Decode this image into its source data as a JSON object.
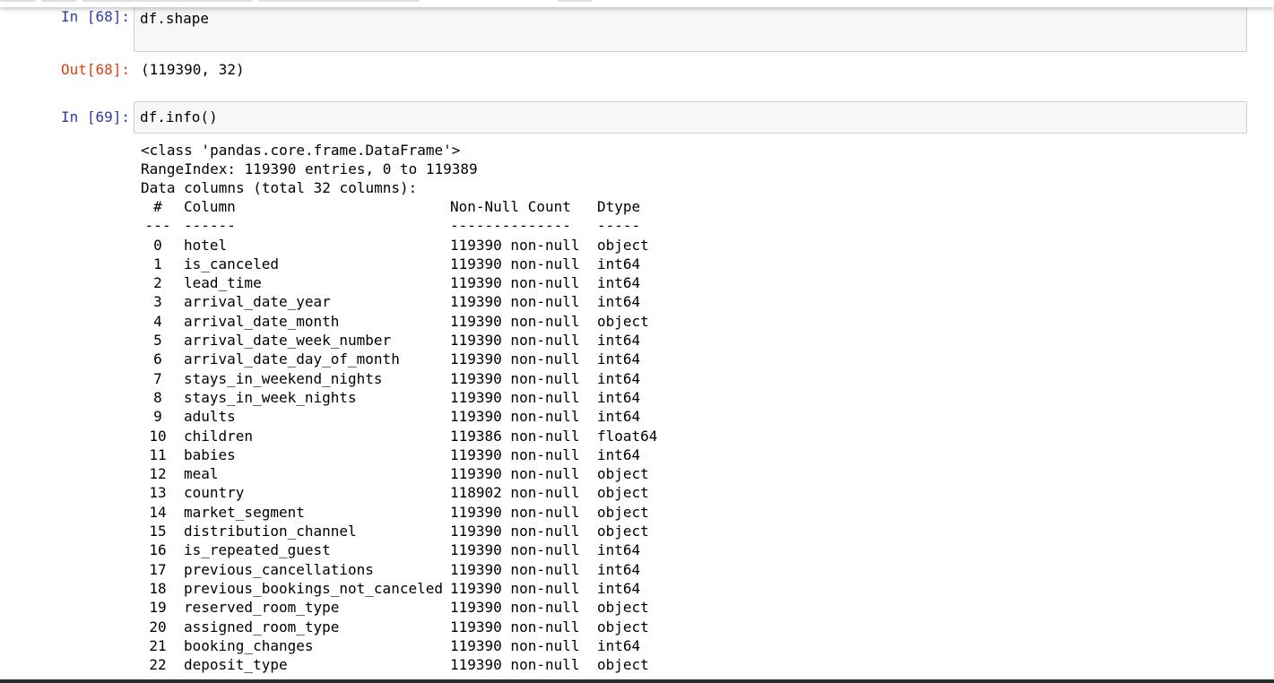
{
  "cells": [
    {
      "in_prompt": "In [68]:",
      "code": "df.shape",
      "out_prompt": "Out[68]:",
      "output": "(119390, 32)"
    },
    {
      "in_prompt": "In [69]:",
      "code": "df.info()",
      "info": {
        "class_line": "<class 'pandas.core.frame.DataFrame'>",
        "range_index_line": "RangeIndex: 119390 entries, 0 to 119389",
        "data_columns_line": "Data columns (total 32 columns):",
        "headers": {
          "idx": "#",
          "column": "Column",
          "count": "Non-Null Count",
          "dtype": "Dtype"
        },
        "separators": {
          "idx": "---",
          "column": "------",
          "count": "--------------",
          "dtype": "-----"
        },
        "rows": [
          {
            "idx": "0",
            "column": "hotel",
            "count": "119390 non-null",
            "dtype": "object"
          },
          {
            "idx": "1",
            "column": "is_canceled",
            "count": "119390 non-null",
            "dtype": "int64"
          },
          {
            "idx": "2",
            "column": "lead_time",
            "count": "119390 non-null",
            "dtype": "int64"
          },
          {
            "idx": "3",
            "column": "arrival_date_year",
            "count": "119390 non-null",
            "dtype": "int64"
          },
          {
            "idx": "4",
            "column": "arrival_date_month",
            "count": "119390 non-null",
            "dtype": "object"
          },
          {
            "idx": "5",
            "column": "arrival_date_week_number",
            "count": "119390 non-null",
            "dtype": "int64"
          },
          {
            "idx": "6",
            "column": "arrival_date_day_of_month",
            "count": "119390 non-null",
            "dtype": "int64"
          },
          {
            "idx": "7",
            "column": "stays_in_weekend_nights",
            "count": "119390 non-null",
            "dtype": "int64"
          },
          {
            "idx": "8",
            "column": "stays_in_week_nights",
            "count": "119390 non-null",
            "dtype": "int64"
          },
          {
            "idx": "9",
            "column": "adults",
            "count": "119390 non-null",
            "dtype": "int64"
          },
          {
            "idx": "10",
            "column": "children",
            "count": "119386 non-null",
            "dtype": "float64"
          },
          {
            "idx": "11",
            "column": "babies",
            "count": "119390 non-null",
            "dtype": "int64"
          },
          {
            "idx": "12",
            "column": "meal",
            "count": "119390 non-null",
            "dtype": "object"
          },
          {
            "idx": "13",
            "column": "country",
            "count": "118902 non-null",
            "dtype": "object"
          },
          {
            "idx": "14",
            "column": "market_segment",
            "count": "119390 non-null",
            "dtype": "object"
          },
          {
            "idx": "15",
            "column": "distribution_channel",
            "count": "119390 non-null",
            "dtype": "object"
          },
          {
            "idx": "16",
            "column": "is_repeated_guest",
            "count": "119390 non-null",
            "dtype": "int64"
          },
          {
            "idx": "17",
            "column": "previous_cancellations",
            "count": "119390 non-null",
            "dtype": "int64"
          },
          {
            "idx": "18",
            "column": "previous_bookings_not_canceled",
            "count": "119390 non-null",
            "dtype": "int64"
          },
          {
            "idx": "19",
            "column": "reserved_room_type",
            "count": "119390 non-null",
            "dtype": "object"
          },
          {
            "idx": "20",
            "column": "assigned_room_type",
            "count": "119390 non-null",
            "dtype": "object"
          },
          {
            "idx": "21",
            "column": "booking_changes",
            "count": "119390 non-null",
            "dtype": "int64"
          },
          {
            "idx": "22",
            "column": "deposit_type",
            "count": "119390 non-null",
            "dtype": "object"
          }
        ]
      }
    }
  ]
}
